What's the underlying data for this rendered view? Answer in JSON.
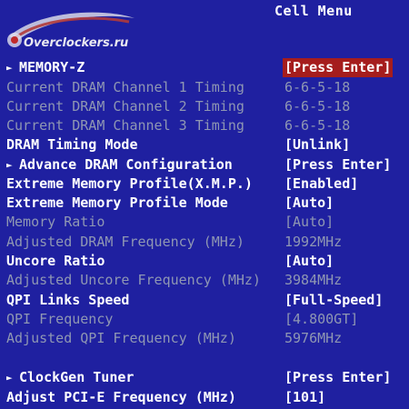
{
  "header": {
    "menu_title": "Cell Menu",
    "watermark_text": "Overclockers.ru"
  },
  "icons": {
    "submenu_arrow": "►"
  },
  "colors": {
    "background": "#1f20a0",
    "active_text": "#ffffff",
    "inactive_text": "#8f97b3",
    "selection_highlight": "#a51d1d"
  },
  "items": [
    {
      "label": "MEMORY-Z",
      "value": "[Press Enter]",
      "submenu": true,
      "enabled": true,
      "selected": true
    },
    {
      "label": "Current DRAM Channel 1 Timing",
      "value": "6-6-5-18",
      "submenu": false,
      "enabled": false
    },
    {
      "label": "Current DRAM Channel 2 Timing",
      "value": "6-6-5-18",
      "submenu": false,
      "enabled": false
    },
    {
      "label": "Current DRAM Channel 3 Timing",
      "value": "6-6-5-18",
      "submenu": false,
      "enabled": false
    },
    {
      "label": "DRAM Timing Mode",
      "value": "[Unlink]",
      "submenu": false,
      "enabled": true
    },
    {
      "label": "Advance DRAM Configuration",
      "value": "[Press Enter]",
      "submenu": true,
      "enabled": true
    },
    {
      "label": "Extreme Memory Profile(X.M.P.)",
      "value": "[Enabled]",
      "submenu": false,
      "enabled": true
    },
    {
      "label": "Extreme Memory Profile Mode",
      "value": "[Auto]",
      "submenu": false,
      "enabled": true
    },
    {
      "label": "Memory Ratio",
      "value": "[Auto]",
      "submenu": false,
      "enabled": false
    },
    {
      "label": "Adjusted DRAM Frequency (MHz)",
      "value": "1992MHz",
      "submenu": false,
      "enabled": false
    },
    {
      "label": "Uncore Ratio",
      "value": "[Auto]",
      "submenu": false,
      "enabled": true
    },
    {
      "label": "Adjusted Uncore Frequency (MHz)",
      "value": "3984MHz",
      "submenu": false,
      "enabled": false
    },
    {
      "label": "QPI Links Speed",
      "value": "[Full-Speed]",
      "submenu": false,
      "enabled": true
    },
    {
      "label": "QPI Frequency",
      "value": "[4.800GT]",
      "submenu": false,
      "enabled": false
    },
    {
      "label": "Adjusted QPI Frequency (MHz)",
      "value": "5976MHz",
      "submenu": false,
      "enabled": false
    },
    {
      "label": "ClockGen Tuner",
      "value": "[Press Enter]",
      "submenu": true,
      "enabled": true
    },
    {
      "label": "Adjust PCI-E Frequency (MHz)",
      "value": "[101]",
      "submenu": false,
      "enabled": true
    }
  ]
}
